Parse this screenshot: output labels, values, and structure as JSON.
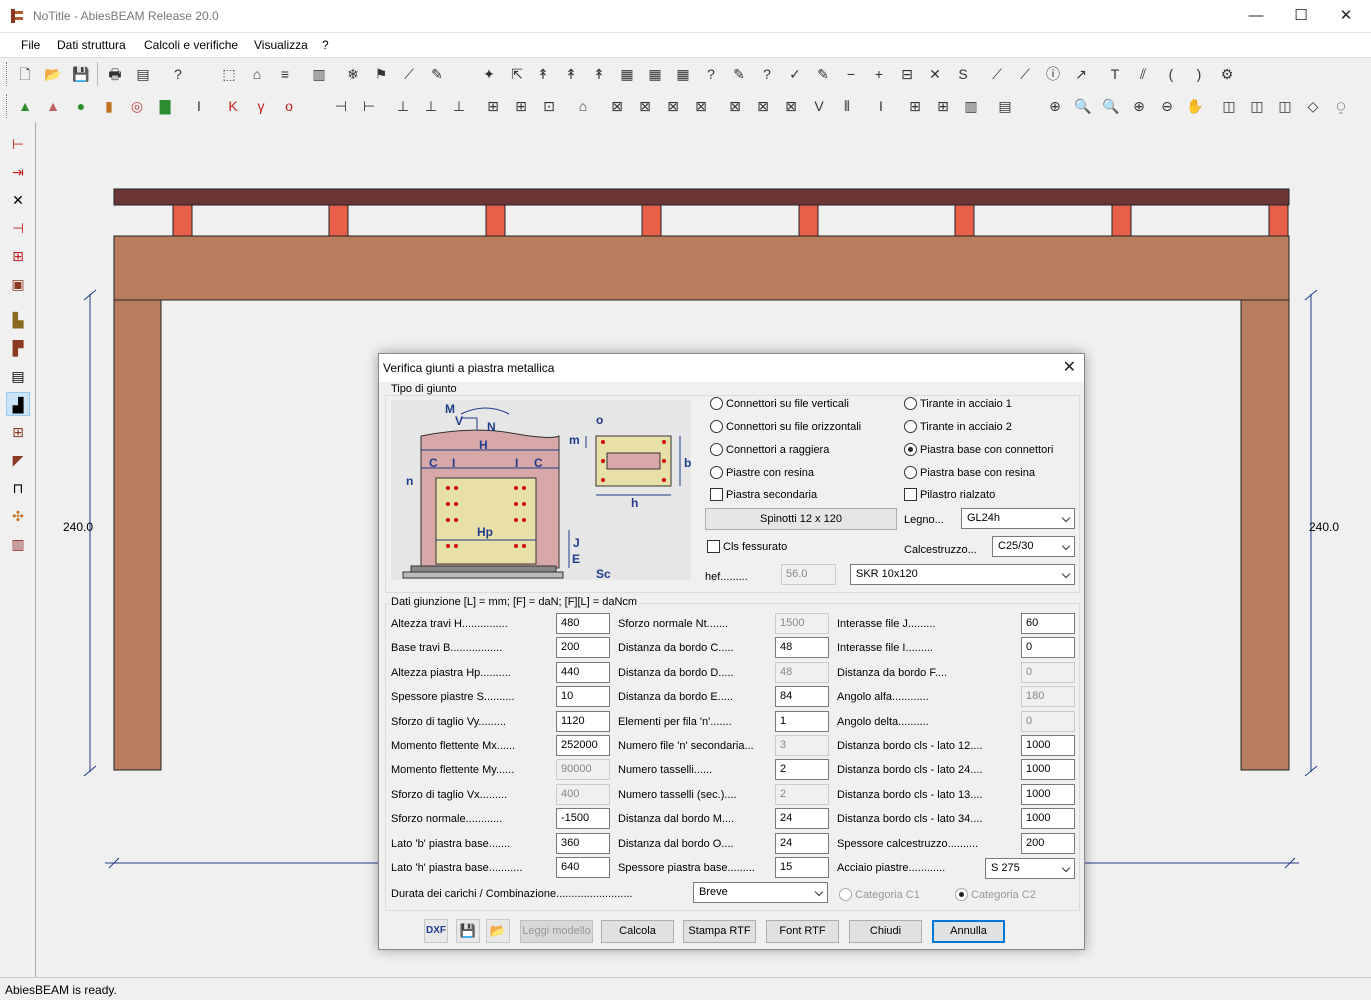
{
  "window": {
    "title": "NoTitle - AbiesBEAM Release 20.0",
    "minimize": "—",
    "maximize": "☐",
    "close": "✕"
  },
  "menu": [
    "File",
    "Dati struttura",
    "Calcoli e verifiche",
    "Visualizza",
    "?"
  ],
  "status": "AbiesBEAM is ready.",
  "drawing": {
    "height_left": "240.0",
    "height_right": "240.0",
    "colors": {
      "roof": "#6b3535",
      "beam": "#b87d5d",
      "block": "#e8604a",
      "line": "#1f3c8c"
    }
  },
  "dialog": {
    "title": "Verifica giunti a piastra metallica",
    "close": "✕",
    "tipo_label": "Tipo di giunto",
    "diagram": {
      "M": "M",
      "V": "V",
      "N": "N",
      "H": "H",
      "C1": "C",
      "I1": "I",
      "I2": "I",
      "C2": "C",
      "n": "n",
      "Hp": "Hp",
      "J": "J",
      "E": "E",
      "Sc": "Sc",
      "o": "o",
      "m": "m",
      "b": "b",
      "h": "h"
    },
    "radios_left": [
      {
        "label": "Connettori su file verticali",
        "on": false
      },
      {
        "label": "Connettori su file orizzontali",
        "on": false
      },
      {
        "label": "Connettori a raggiera",
        "on": false
      },
      {
        "label": "Piastre con resina",
        "on": false
      }
    ],
    "radios_right": [
      {
        "label": "Tirante in acciaio 1",
        "on": false
      },
      {
        "label": "Tirante in acciaio 2",
        "on": false
      },
      {
        "label": "Piastra base con connettori",
        "on": true
      },
      {
        "label": "Piastra base con resina",
        "on": false
      }
    ],
    "chk_secondaria": "Piastra secondaria",
    "chk_rialzato": "Pilastro rialzato",
    "spinotti_btn": "Spinotti 12 x 120",
    "legno_label": "Legno...",
    "legno_value": "GL24h",
    "cls_fessurato": "Cls fessurato",
    "calcestruzzo_label": "Calcestruzzo...",
    "calcestruzzo_value": "C25/30",
    "hef_label": "hef.........",
    "hef_value": "56.0",
    "ancorante_value": "SKR 10x120",
    "dati_label": "Dati giunzione [L] = mm; [F] = daN; [F][L] = daNcm",
    "col1": [
      {
        "label": "Altezza travi H...............",
        "value": "480",
        "dis": false
      },
      {
        "label": "Base travi B.................",
        "value": "200",
        "dis": false
      },
      {
        "label": "Altezza piastra Hp..........",
        "value": "440",
        "dis": false
      },
      {
        "label": "Spessore piastre S..........",
        "value": "10",
        "dis": false
      },
      {
        "label": "Sforzo di taglio Vy.........",
        "value": "1120",
        "dis": false
      },
      {
        "label": "Momento flettente Mx......",
        "value": "252000",
        "dis": false
      },
      {
        "label": "Momento flettente My......",
        "value": "90000",
        "dis": true
      },
      {
        "label": "Sforzo di taglio Vx.........",
        "value": "400",
        "dis": true
      },
      {
        "label": "Sforzo normale............",
        "value": "-1500",
        "dis": false
      },
      {
        "label": "Lato 'b' piastra base.......",
        "value": "360",
        "dis": false
      },
      {
        "label": "Lato 'h' piastra base...........",
        "value": "640",
        "dis": false
      }
    ],
    "col2": [
      {
        "label": "Sforzo normale Nt.......",
        "value": "1500",
        "dis": true
      },
      {
        "label": "Distanza da bordo C.....",
        "value": "48",
        "dis": false
      },
      {
        "label": "Distanza da bordo D.....",
        "value": "48",
        "dis": true
      },
      {
        "label": "Distanza da bordo E.....",
        "value": "84",
        "dis": false
      },
      {
        "label": "Elementi per fila 'n'.......",
        "value": "1",
        "dis": false
      },
      {
        "label": "Numero file 'n' secondaria...",
        "value": "3",
        "dis": true
      },
      {
        "label": "Numero tasselli......",
        "value": "2",
        "dis": false
      },
      {
        "label": "Numero tasselli (sec.)....",
        "value": "2",
        "dis": true
      },
      {
        "label": "Distanza dal bordo M....",
        "value": "24",
        "dis": false
      },
      {
        "label": "Distanza dal bordo O....",
        "value": "24",
        "dis": false
      },
      {
        "label": "Spessore piastra base.........",
        "value": "15",
        "dis": false
      }
    ],
    "col3": [
      {
        "label": "Interasse file J.........",
        "value": "60",
        "dis": false
      },
      {
        "label": "Interasse file I.........",
        "value": "0",
        "dis": false
      },
      {
        "label": "Distanza da bordo F....",
        "value": "0",
        "dis": true
      },
      {
        "label": "Angolo alfa............",
        "value": "180",
        "dis": true
      },
      {
        "label": "Angolo delta..........",
        "value": "0",
        "dis": true
      },
      {
        "label": "Distanza bordo cls - lato 12....",
        "value": "1000",
        "dis": false
      },
      {
        "label": "Distanza bordo cls - lato 24....",
        "value": "1000",
        "dis": false
      },
      {
        "label": "Distanza bordo cls - lato 13....",
        "value": "1000",
        "dis": false
      },
      {
        "label": "Distanza bordo cls - lato 34....",
        "value": "1000",
        "dis": false
      },
      {
        "label": "Spessore calcestruzzo..........",
        "value": "200",
        "dis": false
      }
    ],
    "acciaio_label": "Acciaio piastre............",
    "acciaio_value": "S 275",
    "durata_label": "Durata dei carichi / Combinazione.........................",
    "durata_value": "Breve",
    "cat1": "Categoria C1",
    "cat2": "Categoria C2",
    "dxf_label": "DXF",
    "buttons": {
      "leggi": "Leggi modello",
      "calcola": "Calcola",
      "stampa": "Stampa RTF",
      "font": "Font RTF",
      "chiudi": "Chiudi",
      "annulla": "Annulla"
    }
  }
}
